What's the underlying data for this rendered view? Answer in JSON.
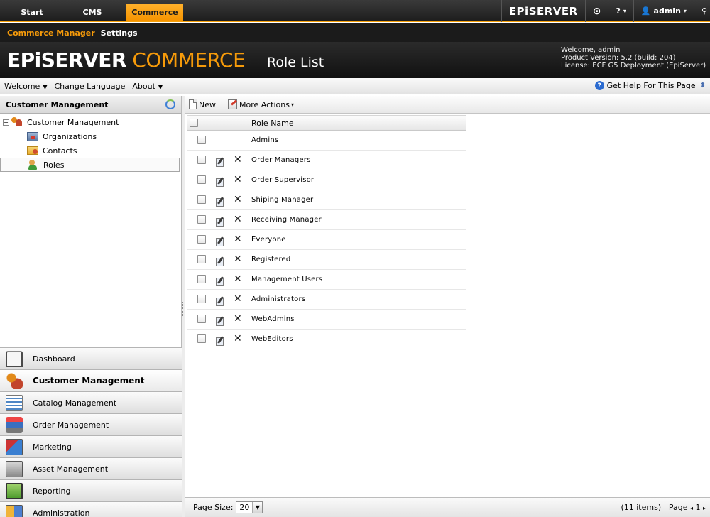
{
  "top_nav": {
    "tabs": [
      {
        "label": "Start"
      },
      {
        "label": "CMS"
      },
      {
        "label": "Commerce"
      }
    ],
    "logo": "EPiSERVER",
    "help": "?",
    "user": "admin",
    "accent": "#f59a0a"
  },
  "sub_nav": {
    "items": [
      {
        "label": "Commerce Manager"
      },
      {
        "label": "Settings"
      }
    ]
  },
  "header": {
    "brand_part1": "EPiSERVER",
    "brand_part2": " COMMERCE",
    "page_title": "Role List",
    "welcome": "Welcome, admin",
    "product_version": "Product Version: 5.2 (build: 204)",
    "license": "License: ECF G5 Deployment (EpiServer)"
  },
  "menubar": {
    "items": [
      {
        "label": "Welcome"
      },
      {
        "label": "Change Language"
      },
      {
        "label": "About"
      }
    ],
    "help_link": "Get Help For This Page"
  },
  "left_panel": {
    "title": "Customer Management",
    "tree": {
      "root": "Customer Management",
      "children": [
        {
          "label": "Organizations"
        },
        {
          "label": "Contacts"
        },
        {
          "label": "Roles"
        }
      ]
    },
    "accordion": [
      {
        "label": "Dashboard",
        "icon": "dashboard-icon"
      },
      {
        "label": "Customer Management",
        "icon": "customer-management-icon"
      },
      {
        "label": "Catalog Management",
        "icon": "catalog-icon"
      },
      {
        "label": "Order Management",
        "icon": "order-icon"
      },
      {
        "label": "Marketing",
        "icon": "marketing-icon"
      },
      {
        "label": "Asset Management",
        "icon": "asset-icon"
      },
      {
        "label": "Reporting",
        "icon": "reporting-icon"
      },
      {
        "label": "Administration",
        "icon": "administration-icon"
      }
    ]
  },
  "toolbar": {
    "new_label": "New",
    "more_actions_label": "More Actions"
  },
  "grid": {
    "column_header": "Role Name",
    "rows": [
      {
        "name": "Admins",
        "editable": false
      },
      {
        "name": "Order Managers",
        "editable": true
      },
      {
        "name": "Order Supervisor",
        "editable": true
      },
      {
        "name": "Shiping Manager",
        "editable": true
      },
      {
        "name": "Receiving Manager",
        "editable": true
      },
      {
        "name": "Everyone",
        "editable": true
      },
      {
        "name": "Registered",
        "editable": true
      },
      {
        "name": "Management Users",
        "editable": true
      },
      {
        "name": "Administrators",
        "editable": true
      },
      {
        "name": "WebAdmins",
        "editable": true
      },
      {
        "name": "WebEditors",
        "editable": true
      }
    ]
  },
  "pager": {
    "page_size_label": "Page Size:",
    "page_size": "20",
    "items_text": "(11 items) | Page",
    "page": "1"
  }
}
